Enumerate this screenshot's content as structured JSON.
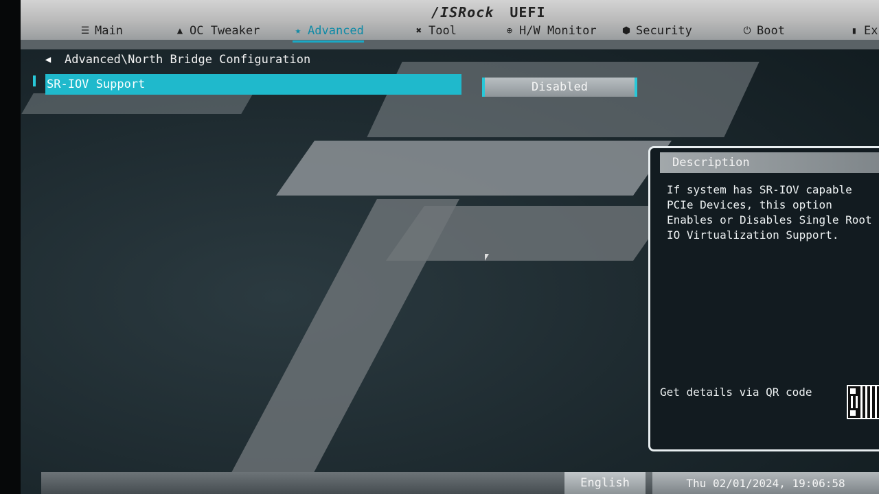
{
  "header": {
    "logo": "/ISRock",
    "logo_suffix": "UEFI",
    "tabs": [
      {
        "label": "Main",
        "icon": "list-icon"
      },
      {
        "label": "OC Tweaker",
        "icon": "rocket-icon"
      },
      {
        "label": "Advanced",
        "icon": "star-icon",
        "active": true
      },
      {
        "label": "Tool",
        "icon": "tools-icon"
      },
      {
        "label": "H/W Monitor",
        "icon": "monitor-icon"
      },
      {
        "label": "Security",
        "icon": "shield-icon"
      },
      {
        "label": "Boot",
        "icon": "power-icon"
      },
      {
        "label": "Ex",
        "icon": "exit-icon"
      }
    ]
  },
  "breadcrumb": {
    "path": "Advanced\\North Bridge Configuration"
  },
  "options": [
    {
      "label": "SR-IOV Support",
      "value": "Disabled",
      "selected": true
    }
  ],
  "description": {
    "title": "Description",
    "text": "If system has SR-IOV capable PCIe Devices, this option Enables or Disables Single Root IO Virtualization Support.",
    "qr_label": "Get details via QR code"
  },
  "footer": {
    "language": "English",
    "datetime": "Thu 02/01/2024, 19:06:58"
  },
  "colors": {
    "accent": "#1fb9cc",
    "topbar": "#b9b9b9",
    "background": "#1b272c"
  }
}
